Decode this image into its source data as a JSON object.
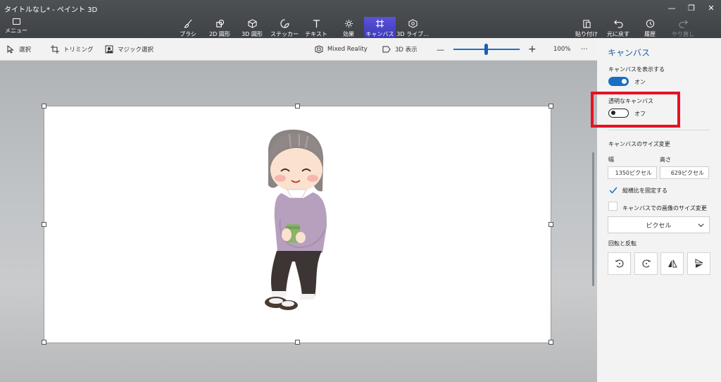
{
  "window": {
    "title": "タイトルなし* - ペイント 3D"
  },
  "menu": {
    "label": "メニュー"
  },
  "tools": [
    {
      "label": "ブラシ",
      "icon": "brush-icon"
    },
    {
      "label": "2D 図形",
      "icon": "2d-shapes-icon"
    },
    {
      "label": "3D 図形",
      "icon": "3d-shapes-icon"
    },
    {
      "label": "ステッカー",
      "icon": "sticker-icon"
    },
    {
      "label": "テキスト",
      "icon": "text-icon"
    },
    {
      "label": "効果",
      "icon": "effects-icon"
    },
    {
      "label": "キャンバス",
      "icon": "canvas-icon"
    },
    {
      "label": "3D ライブ...",
      "icon": "3d-library-icon"
    }
  ],
  "actions": [
    {
      "label": "貼り付け",
      "icon": "paste-icon"
    },
    {
      "label": "元に戻す",
      "icon": "undo-icon"
    },
    {
      "label": "履歴",
      "icon": "history-icon"
    },
    {
      "label": "やり直し",
      "icon": "redo-icon"
    }
  ],
  "subbar": {
    "select": "選択",
    "trim": "トリミング",
    "magic_select": "マジック選択",
    "mixed_reality": "Mixed Reality",
    "view_3d": "3D 表示",
    "zoom_minus": "—",
    "zoom_plus": "+",
    "zoom_value": "100%",
    "more": "···"
  },
  "panel": {
    "title": "キャンバス",
    "show_canvas": {
      "label": "キャンバスを表示する",
      "state": "オン"
    },
    "transparent": {
      "label": "透明なキャンバス",
      "state": "オフ"
    },
    "resize_label": "キャンバスのサイズ変更",
    "width_label": "幅",
    "height_label": "高さ",
    "width_value": "1350ピクセル",
    "height_value": "629ピクセル",
    "lock_ratio": "縦横比を固定する",
    "resize_image": "キャンバスでの画像のサイズ変更",
    "unit": "ピクセル",
    "rotate_label": "回転と反転"
  },
  "colors": {
    "accent": "#1a6fc4",
    "highlight": "#e81123",
    "active_tool": "#4a45c8"
  }
}
